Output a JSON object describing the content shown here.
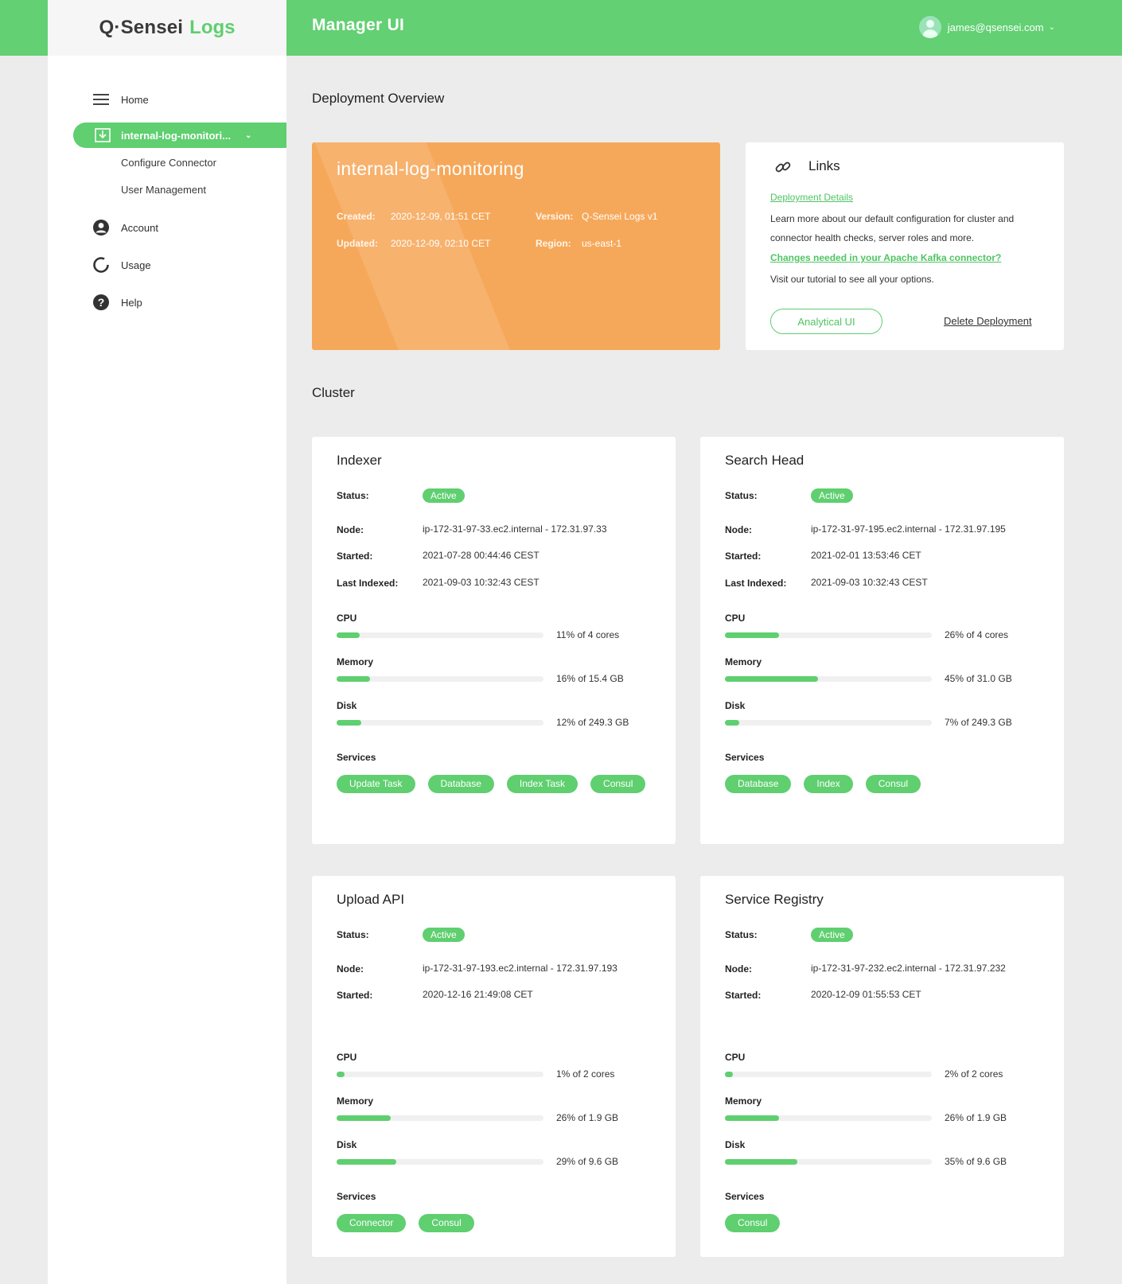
{
  "header": {
    "logo_main": "Q·Sensei",
    "logo_accent": "Logs",
    "app_title": "Manager UI",
    "user_email": "james@qsensei.com"
  },
  "sidebar": {
    "home": "Home",
    "active_item": "internal-log-monitori...",
    "sub_items": [
      "Configure Connector",
      "User Management"
    ],
    "account": "Account",
    "usage": "Usage",
    "help": "Help"
  },
  "overview": {
    "section_title": "Deployment Overview",
    "name": "internal-log-monitoring",
    "created_label": "Created:",
    "created_value": "2020-12-09, 01:51 CET",
    "updated_label": "Updated:",
    "updated_value": "2020-12-09, 02:10 CET",
    "version_label": "Version:",
    "version_value": "Q-Sensei Logs v1",
    "region_label": "Region:",
    "region_value": "us-east-1"
  },
  "links": {
    "title": "Links",
    "deployment_details": "Deployment Details",
    "text1": "Learn more about our default configuration for cluster and connector health checks, server roles and more.",
    "kafka_link": "Changes needed in your Apache Kafka connector?",
    "text2": "Visit our tutorial to see all your options.",
    "analytical_ui": "Analytical UI",
    "delete": "Delete Deployment"
  },
  "cluster": {
    "section_title": "Cluster",
    "labels": {
      "status": "Status:",
      "node": "Node:",
      "started": "Started:",
      "last_indexed": "Last Indexed:",
      "cpu": "CPU",
      "memory": "Memory",
      "disk": "Disk",
      "services": "Services"
    },
    "cards": [
      {
        "title": "Indexer",
        "status": "Active",
        "node": "ip-172-31-97-33.ec2.internal - 172.31.97.33",
        "started": "2021-07-28 00:44:46 CEST",
        "last_indexed": "2021-09-03 10:32:43 CEST",
        "cpu": {
          "pct": 11,
          "text": "11% of 4 cores"
        },
        "memory": {
          "pct": 16,
          "text": "16% of 15.4 GB"
        },
        "disk": {
          "pct": 12,
          "text": "12% of 249.3 GB"
        },
        "services": [
          "Update Task",
          "Database",
          "Index Task",
          "Consul"
        ]
      },
      {
        "title": "Search Head",
        "status": "Active",
        "node": "ip-172-31-97-195.ec2.internal - 172.31.97.195",
        "started": "2021-02-01 13:53:46 CET",
        "last_indexed": "2021-09-03 10:32:43 CEST",
        "cpu": {
          "pct": 26,
          "text": "26% of 4 cores"
        },
        "memory": {
          "pct": 45,
          "text": "45% of 31.0 GB"
        },
        "disk": {
          "pct": 7,
          "text": "7% of 249.3 GB"
        },
        "services": [
          "Database",
          "Index",
          "Consul"
        ]
      },
      {
        "title": "Upload API",
        "status": "Active",
        "node": "ip-172-31-97-193.ec2.internal - 172.31.97.193",
        "started": "2020-12-16 21:49:08 CET",
        "cpu": {
          "pct": 1,
          "text": "1% of 2 cores"
        },
        "memory": {
          "pct": 26,
          "text": "26% of 1.9 GB"
        },
        "disk": {
          "pct": 29,
          "text": "29% of 9.6 GB"
        },
        "services": [
          "Connector",
          "Consul"
        ]
      },
      {
        "title": "Service Registry",
        "status": "Active",
        "node": "ip-172-31-97-232.ec2.internal - 172.31.97.232",
        "started": "2020-12-09 01:55:53 CET",
        "cpu": {
          "pct": 2,
          "text": "2% of 2 cores"
        },
        "memory": {
          "pct": 26,
          "text": "26% of 1.9 GB"
        },
        "disk": {
          "pct": 35,
          "text": "35% of 9.6 GB"
        },
        "services": [
          "Consul"
        ]
      }
    ]
  },
  "colors": {
    "brand_green": "#62d073",
    "overview_orange": "#f6a85a"
  }
}
